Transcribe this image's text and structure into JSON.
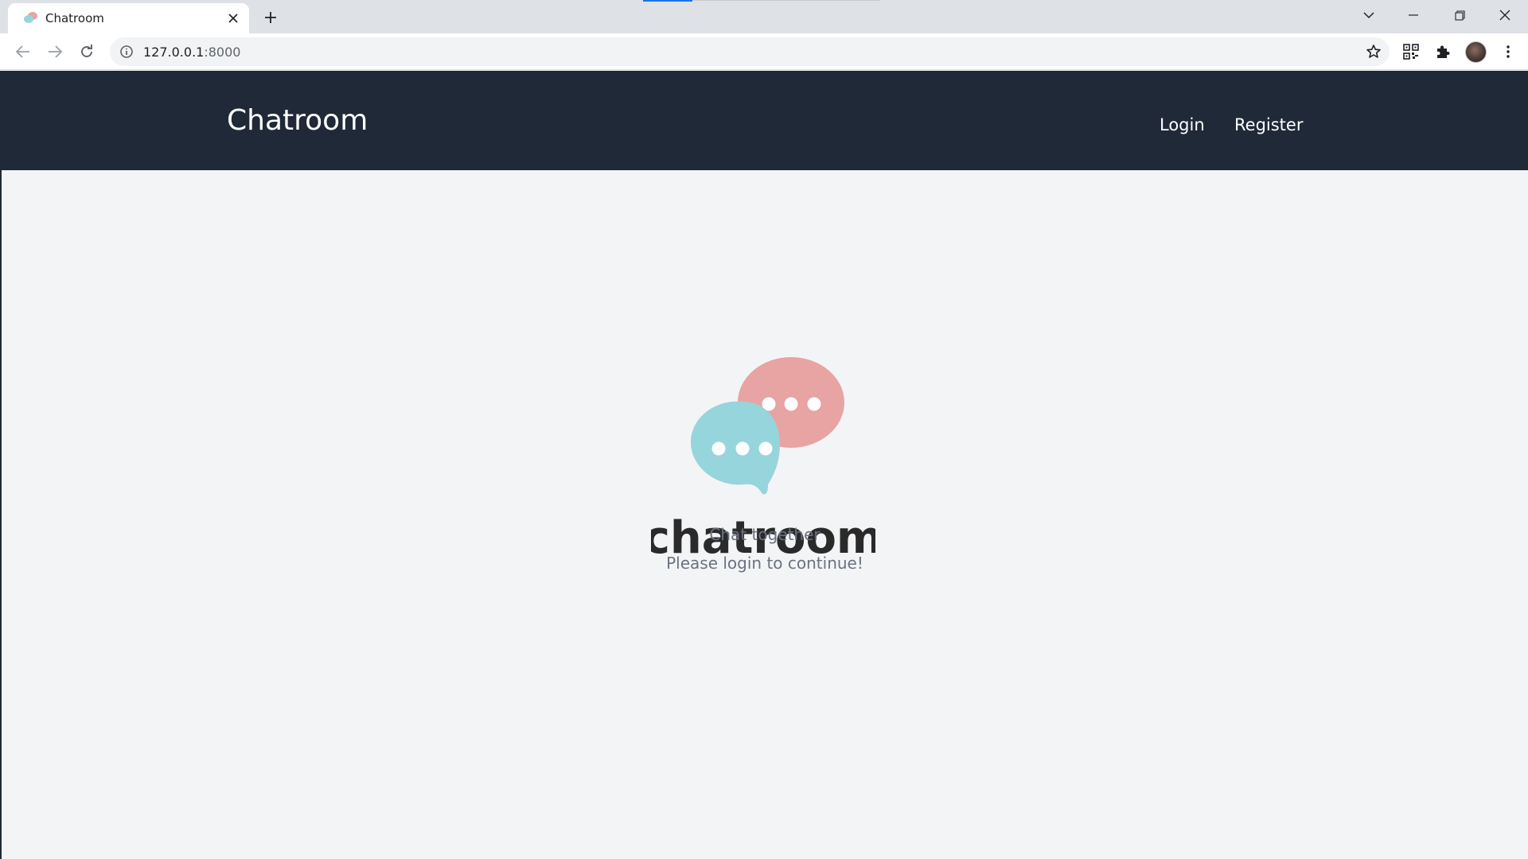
{
  "browser": {
    "tab_title": "Chatroom",
    "url_host": "127.0.0.1",
    "url_port": ":8000"
  },
  "navbar": {
    "brand": "Chatroom",
    "links": [
      {
        "label": "Login"
      },
      {
        "label": "Register"
      }
    ]
  },
  "hero": {
    "logo_wordmark": "chatroom",
    "tagline": "Chat together",
    "subtitle": "Please login to continue!"
  },
  "colors": {
    "navbar_bg": "#1f2937",
    "page_bg": "#f3f4f6",
    "bubble_pink": "#e8a3a3",
    "bubble_teal": "#96d5db",
    "muted_text": "#6b7280"
  }
}
